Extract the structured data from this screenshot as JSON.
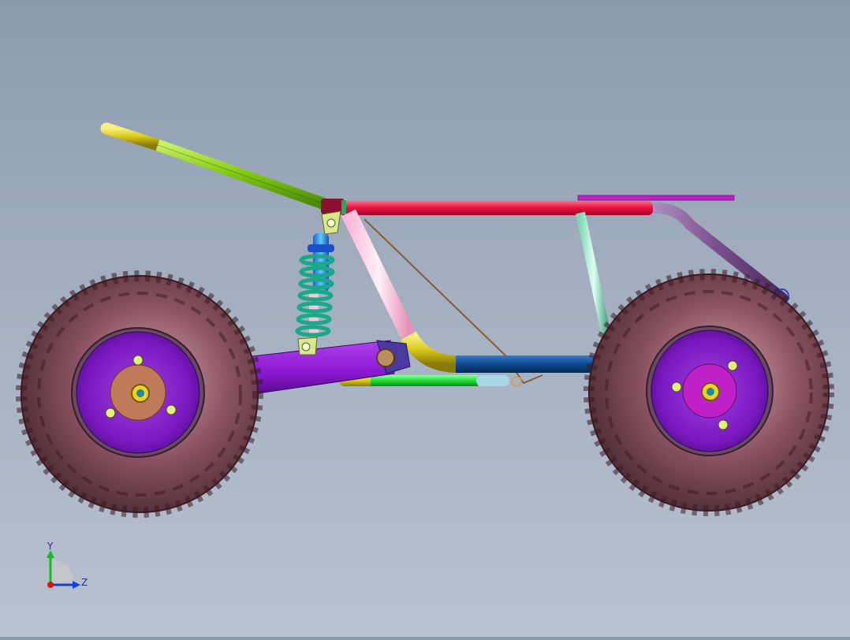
{
  "triad": {
    "y_label": "Y",
    "z_label": "Z"
  },
  "colors": {
    "background_top": "#8c9aae",
    "background_bottom": "#b8c1cf",
    "tire": "#7a4a55",
    "rim": "#8a22c9",
    "seat_tube": "#8fd11a",
    "top_tube": "#e8204a",
    "rear_strut": "#7a4f8e",
    "swingarm": "#9020d0",
    "shock_spring": "#1aa888",
    "lower_tube": "#0f4a8a",
    "bend_tube": "#e0c020",
    "skid_tube": "#22dd33"
  }
}
